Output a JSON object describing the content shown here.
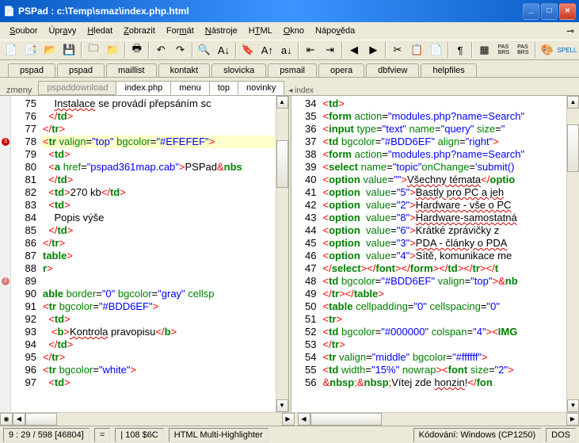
{
  "window": {
    "title": "PSPad : c:\\Temp\\smaz\\index.php.html"
  },
  "menu": {
    "items": [
      "Soubor",
      "Úpravy",
      "Hledat",
      "Zobrazit",
      "Formát",
      "Nástroje",
      "HTML",
      "Okno",
      "Nápověda"
    ]
  },
  "toolbar": {
    "icons": [
      "file-new",
      "file-new2",
      "file-open",
      "save",
      "sep",
      "folder-new",
      "folder-open",
      "sep",
      "print",
      "sep",
      "undo",
      "redo",
      "sep",
      "find",
      "find-next",
      "sep",
      "bookmark",
      "sort-asc",
      "sort-desc",
      "sep",
      "indent-left",
      "indent-right",
      "sep",
      "nav-back",
      "nav-fwd",
      "sep",
      "cut",
      "copy",
      "paste",
      "sep",
      "pilcrow",
      "sep",
      "form",
      "grid-pas",
      "grid-brs",
      "sep",
      "color",
      "spell"
    ]
  },
  "tabs1": [
    "pspad",
    "pspad",
    "maillist",
    "kontakt",
    "slovicka",
    "psmail",
    "opera",
    "dbfview",
    "helpfiles"
  ],
  "doc_tabs": {
    "left_label": "zmeny",
    "items": [
      "pspaddownload",
      "index.php",
      "menu",
      "top",
      "novinky"
    ],
    "right_marker": "◂ index"
  },
  "left_lines": [
    {
      "n": 75,
      "html": "    <span class='wavy'>Instalace</span> se provádí přepsáním sc"
    },
    {
      "n": 76,
      "html": "  <span class='sym'>&lt;/</span><span class='kw'>td</span><span class='sym'>&gt;</span>"
    },
    {
      "n": 77,
      "html": "<span class='sym'>&lt;/</span><span class='kw'>tr</span><span class='sym'>&gt;</span>"
    },
    {
      "n": 78,
      "html": "<span class='sym'>&lt;</span><span class='kw'>tr</span> <span class='attr'>valign</span>=<span class='str'>\"top\"</span> <span class='attr'>bgcolor</span>=<span class='str'>\"#EFEFEF\"</span><span class='sym'>&gt;</span>"
    },
    {
      "n": 79,
      "html": "  <span class='sym'>&lt;</span><span class='kw'>td</span><span class='sym'>&gt;</span>"
    },
    {
      "n": 80,
      "html": "  <span class='sym'>&lt;</span><span class='kw'>a</span> <span class='attr'>href</span>=<span class='str'>\"pspad361map.cab\"</span><span class='sym'>&gt;</span>PSPad<span class='sym'>&amp;</span><span class='kw'>nbs</span>"
    },
    {
      "n": 81,
      "html": "  <span class='sym'>&lt;/</span><span class='kw'>td</span><span class='sym'>&gt;</span>"
    },
    {
      "n": 82,
      "html": "  <span class='sym'>&lt;</span><span class='kw'>td</span><span class='sym'>&gt;</span>270 kb<span class='sym'>&lt;/</span><span class='kw'>td</span><span class='sym'>&gt;</span>"
    },
    {
      "n": 83,
      "html": "  <span class='sym'>&lt;</span><span class='kw'>td</span><span class='sym'>&gt;</span>"
    },
    {
      "n": 84,
      "html": "    Popis výše"
    },
    {
      "n": 85,
      "html": "  <span class='sym'>&lt;/</span><span class='kw'>td</span><span class='sym'>&gt;</span>"
    },
    {
      "n": 86,
      "html": "<span class='sym'>&lt;/</span><span class='kw'>tr</span><span class='sym'>&gt;</span>"
    },
    {
      "n": 87,
      "html": "<span class='kw'>table</span><span class='sym'>&gt;</span>"
    },
    {
      "n": 88,
      "html": "<span class='kw'>r</span><span class='sym'>&gt;</span>"
    },
    {
      "n": 89,
      "html": " "
    },
    {
      "n": 90,
      "html": "<span class='kw'>able</span> <span class='attr'>border</span>=<span class='str'>\"0\"</span> <span class='attr'>bgcolor</span>=<span class='str'>\"gray\"</span> <span class='attr'>cellsp</span>"
    },
    {
      "n": 91,
      "html": "<span class='sym'>&lt;</span><span class='kw'>tr</span> <span class='attr'>bgcolor</span>=<span class='str'>\"#BDD6EF\"</span><span class='sym'>&gt;</span>"
    },
    {
      "n": 92,
      "html": "  <span class='sym'>&lt;</span><span class='kw'>td</span><span class='sym'>&gt;</span>"
    },
    {
      "n": 93,
      "html": "   <span class='sym'>&lt;</span><span class='kw'>b</span><span class='sym'>&gt;</span><span class='wavy'>Kontrola</span> pravopisu<span class='sym'>&lt;/</span><span class='kw'>b</span><span class='sym'>&gt;</span>"
    },
    {
      "n": 94,
      "html": "  <span class='sym'>&lt;/</span><span class='kw'>td</span><span class='sym'>&gt;</span>"
    },
    {
      "n": 95,
      "html": "<span class='sym'>&lt;/</span><span class='kw'>tr</span><span class='sym'>&gt;</span>"
    },
    {
      "n": 96,
      "html": "<span class='sym'>&lt;</span><span class='kw'>tr</span> <span class='attr'>bgcolor</span>=<span class='str'>\"white\"</span><span class='sym'>&gt;</span>"
    },
    {
      "n": 97,
      "html": "  <span class='sym'>&lt;</span><span class='kw'>td</span><span class='sym'>&gt;</span>"
    }
  ],
  "right_lines": [
    {
      "n": 34,
      "html": "<span class='sym'>&lt;</span><span class='kw'>td</span><span class='sym'>&gt;</span>"
    },
    {
      "n": 35,
      "html": "<span class='sym'>&lt;</span><span class='kw'>form</span> <span class='attr'>action</span>=<span class='str'>\"modules.php?name=Search\"</span>"
    },
    {
      "n": 36,
      "html": "<span class='sym'>&lt;</span><span class='kw'>input</span> <span class='attr'>type</span>=<span class='str'>\"text\"</span> <span class='attr'>name</span>=<span class='str'>\"query\"</span> <span class='attr'>size</span>=<span class='str'>\"</span>"
    },
    {
      "n": 37,
      "html": "<span class='sym'>&lt;</span><span class='kw'>td</span> <span class='attr'>bgcolor</span>=<span class='str'>\"#BDD6EF\"</span> <span class='attr'>align</span>=<span class='str'>\"right\"</span><span class='sym'>&gt;</span>"
    },
    {
      "n": 38,
      "html": "<span class='sym'>&lt;</span><span class='kw'>form</span> <span class='attr'>action</span>=<span class='str'>\"modules.php?name=Search\"</span>"
    },
    {
      "n": 39,
      "html": "<span class='sym'>&lt;</span><span class='kw'>select</span> <span class='attr'>name</span>=<span class='str'>\"topic\"</span><span class='attr'>onChange</span>=<span class='str'>'submit()</span>"
    },
    {
      "n": 40,
      "html": "<span class='sym'>&lt;</span><span class='kw'>option</span> <span class='attr'>value</span>=<span class='str'>\"\"</span><span class='sym'>&gt;</span><span class='wavy'>Všechny témata</span><span class='sym'>&lt;/</span><span class='kw'>optio</span>"
    },
    {
      "n": 41,
      "html": "<span class='sym'>&lt;</span><span class='kw'>option</span>  <span class='attr'>value</span>=<span class='str'>\"5\"</span><span class='sym'>&gt;</span><span class='wavy'>Bastly pro PC a jeh</span>"
    },
    {
      "n": 42,
      "html": "<span class='sym'>&lt;</span><span class='kw'>option</span>  <span class='attr'>value</span>=<span class='str'>\"2\"</span><span class='sym'>&gt;</span><span class='wavy'>Hardware - vše o PC</span>"
    },
    {
      "n": 43,
      "html": "<span class='sym'>&lt;</span><span class='kw'>option</span>  <span class='attr'>value</span>=<span class='str'>\"8\"</span><span class='sym'>&gt;</span><span class='wavy'>Hardware-samostatná</span>"
    },
    {
      "n": 44,
      "html": "<span class='sym'>&lt;</span><span class='kw'>option</span>  <span class='attr'>value</span>=<span class='str'>\"6\"</span><span class='sym'>&gt;</span>Krátké zprávičky z "
    },
    {
      "n": 45,
      "html": "<span class='sym'>&lt;</span><span class='kw'>option</span>  <span class='attr'>value</span>=<span class='str'>\"3\"</span><span class='sym'>&gt;</span><span class='wavy'>PDA - články o PDA</span>"
    },
    {
      "n": 46,
      "html": "<span class='sym'>&lt;</span><span class='kw'>option</span>  <span class='attr'>value</span>=<span class='str'>\"4\"</span><span class='sym'>&gt;</span>Sítě, komunikace me"
    },
    {
      "n": 47,
      "html": "<span class='sym'>&lt;/</span><span class='kw'>select</span><span class='sym'>&gt;&lt;/</span><span class='kw'>font</span><span class='sym'>&gt;&lt;/</span><span class='kw'>form</span><span class='sym'>&gt;&lt;/</span><span class='kw'>td</span><span class='sym'>&gt;&lt;/</span><span class='kw'>tr</span><span class='sym'>&gt;&lt;/</span><span class='kw'>t</span>"
    },
    {
      "n": 48,
      "html": "<span class='sym'>&lt;</span><span class='kw'>td</span> <span class='attr'>bgcolor</span>=<span class='str'>\"#BDD6EF\"</span> <span class='attr'>valign</span>=<span class='str'>\"top\"</span><span class='sym'>&gt;&amp;</span><span class='kw'>nb</span>"
    },
    {
      "n": 49,
      "html": "<span class='sym'>&lt;/</span><span class='kw'>tr</span><span class='sym'>&gt;&lt;/</span><span class='kw'>table</span><span class='sym'>&gt;</span>"
    },
    {
      "n": 50,
      "html": "<span class='sym'>&lt;</span><span class='kw'>table</span> <span class='attr'>cellpadding</span>=<span class='str'>\"0\"</span> <span class='attr'>cellspacing</span>=<span class='str'>\"0\"</span>"
    },
    {
      "n": 51,
      "html": "<span class='sym'>&lt;</span><span class='kw'>tr</span><span class='sym'>&gt;</span>"
    },
    {
      "n": 52,
      "html": "<span class='sym'>&lt;</span><span class='kw'>td</span> <span class='attr'>bgcolor</span>=<span class='str'>\"#000000\"</span> <span class='attr'>colspan</span>=<span class='str'>\"4\"</span><span class='sym'>&gt;&lt;</span><span class='kw'>IMG</span>"
    },
    {
      "n": 53,
      "html": "<span class='sym'>&lt;/</span><span class='kw'>tr</span><span class='sym'>&gt;</span>"
    },
    {
      "n": 54,
      "html": "<span class='sym'>&lt;</span><span class='kw'>tr</span> <span class='attr'>valign</span>=<span class='str'>\"middle\"</span> <span class='attr'>bgcolor</span>=<span class='str'>\"#ffffff\"</span><span class='sym'>&gt;</span>"
    },
    {
      "n": 55,
      "html": "<span class='sym'>&lt;</span><span class='kw'>td</span> <span class='attr'>width</span>=<span class='str'>\"15%\"</span> <span class='attr'>nowrap</span><span class='sym'>&gt;&lt;</span><span class='kw'>font</span> <span class='attr'>size</span>=<span class='str'>\"2\"</span><span class='sym'>&gt;</span>"
    },
    {
      "n": 56,
      "html": "<span class='sym'>&amp;</span><span class='kw'>nbsp</span><span class='sym'>;&amp;</span><span class='kw'>nbsp</span><span class='sym'>;</span>Vítej zde <span class='wavy'>honzin</span>!<span class='sym'>&lt;/</span><span class='kw'>fon</span>"
    }
  ],
  "bookmarks_left": [
    {
      "row": 3,
      "label": "3"
    },
    {
      "row": 14,
      "label": "2",
      "dim": true
    }
  ],
  "status": {
    "pos": "9 : 29 / 598  [46804]",
    "modified": "=",
    "col": "|  108  $6C",
    "mode": "HTML Multi-Highlighter",
    "enc": "Kódování: Windows (CP1250)",
    "dos": "DOS"
  }
}
